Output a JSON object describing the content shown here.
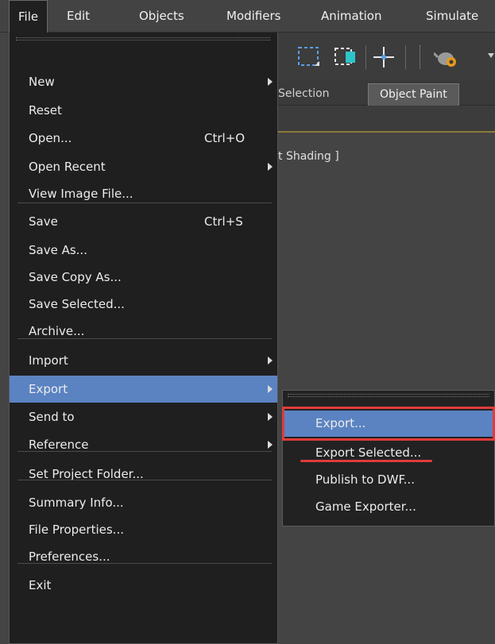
{
  "menubar": {
    "items": [
      "File",
      "Edit",
      "Objects",
      "Modifiers",
      "Animation",
      "Simulate"
    ]
  },
  "ribbon": {
    "tabs": [
      "Selection",
      "Object Paint"
    ]
  },
  "viewport": {
    "label": "t Shading ]"
  },
  "file_menu": {
    "items": [
      {
        "label": "New",
        "mnemonic": "N",
        "shortcut": "",
        "submenu": true
      },
      {
        "label": "Reset",
        "mnemonic": "R",
        "shortcut": "",
        "submenu": false
      },
      {
        "label": "Open...",
        "mnemonic": "O",
        "shortcut": "Ctrl+O",
        "submenu": false
      },
      {
        "label": "Open Recent",
        "mnemonic": "t",
        "shortcut": "",
        "submenu": true
      },
      {
        "label": "View Image File...",
        "mnemonic": "V",
        "shortcut": "",
        "submenu": false
      },
      {
        "label": "Save",
        "mnemonic": "S",
        "shortcut": "Ctrl+S",
        "submenu": false
      },
      {
        "label": "Save As...",
        "mnemonic": "A",
        "shortcut": "",
        "submenu": false
      },
      {
        "label": "Save Copy As...",
        "mnemonic": "C",
        "shortcut": "",
        "submenu": false
      },
      {
        "label": "Save Selected...",
        "mnemonic": "d",
        "shortcut": "",
        "submenu": false
      },
      {
        "label": "Archive...",
        "mnemonic": "h",
        "shortcut": "",
        "submenu": false
      },
      {
        "label": "Import",
        "mnemonic": "I",
        "shortcut": "",
        "submenu": true
      },
      {
        "label": "Export",
        "mnemonic": "E",
        "shortcut": "",
        "submenu": true,
        "highlighted": true
      },
      {
        "label": "Send to",
        "mnemonic": "S",
        "shortcut": "",
        "submenu": true
      },
      {
        "label": "Reference",
        "mnemonic": "R",
        "shortcut": "",
        "submenu": true
      },
      {
        "label": "Set Project Folder...",
        "mnemonic": "",
        "shortcut": "",
        "submenu": false
      },
      {
        "label": "Summary Info...",
        "mnemonic": "u",
        "shortcut": "",
        "submenu": false
      },
      {
        "label": "File Properties...",
        "mnemonic": "P",
        "shortcut": "",
        "submenu": false
      },
      {
        "label": "Preferences...",
        "mnemonic": "P",
        "shortcut": "",
        "submenu": false
      },
      {
        "label": "Exit",
        "mnemonic": "x",
        "shortcut": "",
        "submenu": false
      }
    ]
  },
  "export_submenu": {
    "items": [
      {
        "label": "Export...",
        "highlighted": true
      },
      {
        "label": "Export Selected...",
        "highlighted": false
      },
      {
        "label": "Publish to DWF...",
        "highlighted": false
      },
      {
        "label": "Game Exporter...",
        "highlighted": false
      }
    ]
  },
  "colors": {
    "highlight": "#5b83c2",
    "annotation": "#e03b3b",
    "menu_bg": "#1f1f1f"
  }
}
